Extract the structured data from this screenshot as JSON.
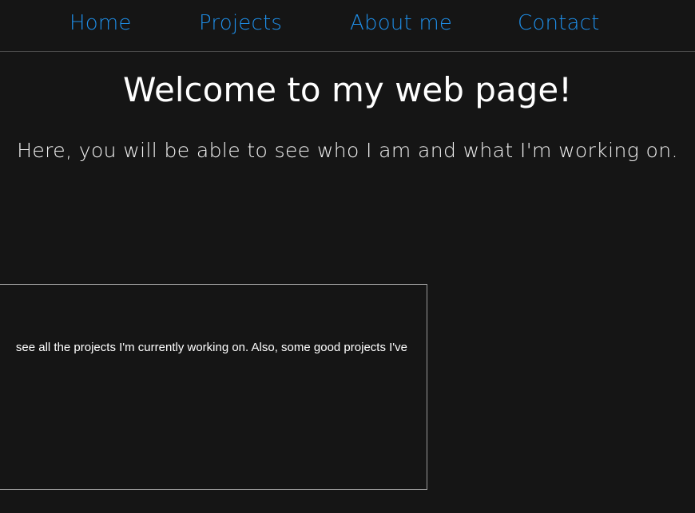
{
  "nav": {
    "items": [
      {
        "label": "Home"
      },
      {
        "label": "Projects"
      },
      {
        "label": "About me"
      },
      {
        "label": "Contact"
      }
    ],
    "link_color": "#1e8ee8"
  },
  "hero": {
    "title": "Welcome to my web page!",
    "subtitle": "Here, you will be able to see who I am and what I'm working on."
  },
  "projects_card": {
    "text": "see all the projects I'm currently working on. Also, some good projects I've"
  },
  "colors": {
    "background": "#151515",
    "text": "#ffffff",
    "border": "#9a9a9a"
  }
}
